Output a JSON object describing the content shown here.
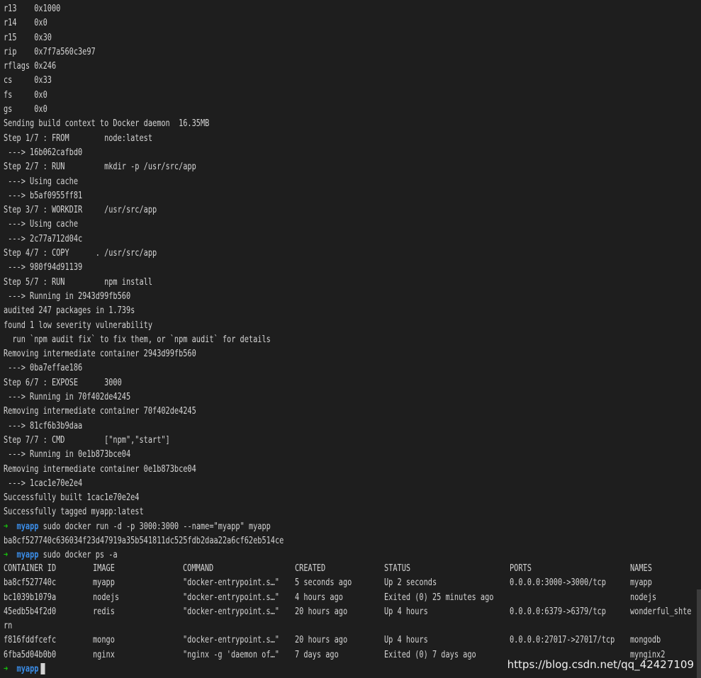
{
  "terminal": {
    "lines": [
      "r13    0x1000",
      "r14    0x0",
      "r15    0x30",
      "rip    0x7f7a560c3e97",
      "rflags 0x246",
      "cs     0x33",
      "fs     0x0",
      "gs     0x0",
      "Sending build context to Docker daemon  16.35MB",
      "Step 1/7 : FROM        node:latest",
      " ---> 16b062cafbd0",
      "Step 2/7 : RUN         mkdir -p /usr/src/app",
      " ---> Using cache",
      " ---> b5af0955ff81",
      "Step 3/7 : WORKDIR     /usr/src/app",
      " ---> Using cache",
      " ---> 2c77a712d04c",
      "Step 4/7 : COPY      . /usr/src/app",
      " ---> 980f94d91139",
      "Step 5/7 : RUN         npm install",
      " ---> Running in 2943d99fb560",
      "audited 247 packages in 1.739s",
      "found 1 low severity vulnerability",
      "  run `npm audit fix` to fix them, or `npm audit` for details",
      "Removing intermediate container 2943d99fb560",
      " ---> 0ba7effae186",
      "Step 6/7 : EXPOSE      3000",
      " ---> Running in 70f402de4245",
      "Removing intermediate container 70f402de4245",
      " ---> 81cf6b3b9daa",
      "Step 7/7 : CMD         [\"npm\",\"start\"]",
      " ---> Running in 0e1b873bce04",
      "Removing intermediate container 0e1b873bce04",
      " ---> 1cac1e70e2e4",
      "Successfully built 1cac1e70e2e4",
      "Successfully tagged myapp:latest"
    ],
    "prompt": {
      "arrow": "➜",
      "dir": "myapp"
    },
    "run_command": "sudo docker run -d -p 3000:3000 --name=\"myapp\" myapp",
    "container_hash": "ba8cf527740c636034f23d47919a35b541811dc525fdb2daa22a6cf62eb514ce",
    "ps_command": "sudo docker ps -a",
    "ps_table": {
      "headers": [
        "CONTAINER ID",
        "IMAGE",
        "COMMAND",
        "CREATED",
        "STATUS",
        "PORTS",
        "NAMES"
      ],
      "rows": [
        [
          "ba8cf527740c",
          "myapp",
          "\"docker-entrypoint.s…\"",
          "5 seconds ago",
          "Up 2 seconds",
          "0.0.0.0:3000->3000/tcp",
          "myapp"
        ],
        [
          "bc1039b1079a",
          "nodejs",
          "\"docker-entrypoint.s…\"",
          "4 hours ago",
          "Exited (0) 25 minutes ago",
          "",
          "nodejs"
        ],
        [
          "45edb5b4f2d0",
          "redis",
          "\"docker-entrypoint.s…\"",
          "20 hours ago",
          "Up 4 hours",
          "0.0.0.0:6379->6379/tcp",
          "wonderful_shte"
        ],
        [
          "f816fddfcefc",
          "mongo",
          "\"docker-entrypoint.s…\"",
          "20 hours ago",
          "Up 4 hours",
          "0.0.0.0:27017->27017/tcp",
          "mongodb"
        ],
        [
          "6fba5d04b0b0",
          "nginx",
          "\"nginx -g 'daemon of…\"",
          "7 days ago",
          "Exited (0) 7 days ago",
          "",
          "mynginx2"
        ]
      ],
      "wrap_continuation": "rn"
    },
    "watermark": "https://blog.csdn.net/qq_42427109"
  }
}
